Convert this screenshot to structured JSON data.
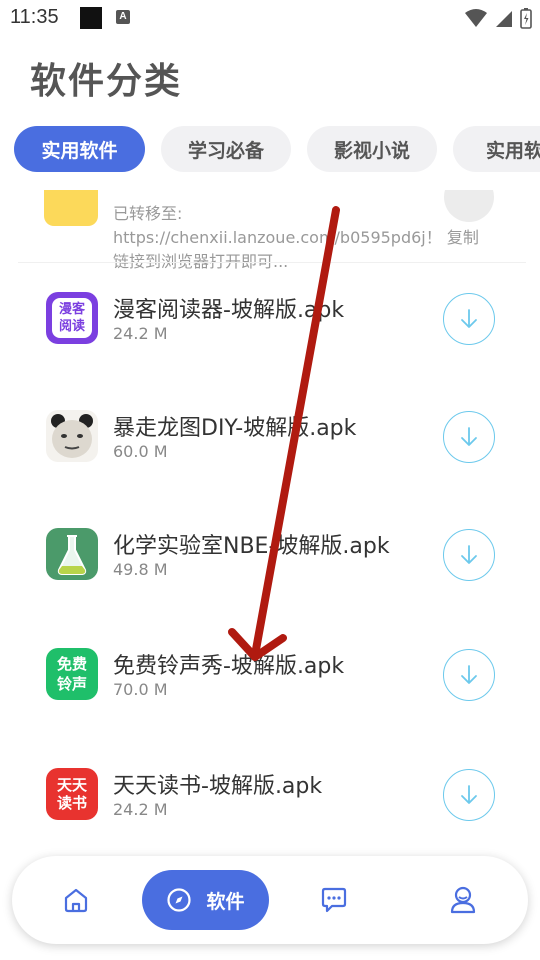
{
  "status_bar": {
    "time": "11:35",
    "notification_icon_letter": "A"
  },
  "page": {
    "title": "软件分类"
  },
  "tabs": [
    {
      "label": "实用软件",
      "active": true
    },
    {
      "label": "学习必备",
      "active": false
    },
    {
      "label": "影视小说",
      "active": false
    },
    {
      "label": "实用软",
      "active": false
    }
  ],
  "notice": {
    "line1": "已转移至:",
    "line2": "https://chenxii.lanzoue.com/b0595pd6j！ 复制",
    "line3": "链接到浏览器打开即可..."
  },
  "apps": [
    {
      "name": "漫客阅读器-坡解版.apk",
      "size": "24.2 M",
      "icon_text": "漫客\n阅读",
      "icon_color": "#7b3fe0"
    },
    {
      "name": "暴走龙图DIY-坡解版.apk",
      "size": "60.0 M",
      "icon_text": "",
      "icon_color": "#e8e4de"
    },
    {
      "name": "化学实验室NBE-坡解版.apk",
      "size": "49.8 M",
      "icon_text": "",
      "icon_color": "#4b9a6a"
    },
    {
      "name": "免费铃声秀-坡解版.apk",
      "size": "70.0 M",
      "icon_text": "免费\n铃声",
      "icon_color": "#1fbf6a"
    },
    {
      "name": "天天读书-坡解版.apk",
      "size": "24.2 M",
      "icon_text": "天天\n读书",
      "icon_color": "#e8332f"
    }
  ],
  "bottom_nav": {
    "items": [
      {
        "icon": "home-icon",
        "label": ""
      },
      {
        "icon": "compass-icon",
        "label": "软件",
        "active": true
      },
      {
        "icon": "chat-icon",
        "label": ""
      },
      {
        "icon": "profile-icon",
        "label": ""
      }
    ]
  },
  "colors": {
    "accent": "#4a6ee0",
    "download_outline": "#6cc9ec",
    "annotation_arrow": "#b01a10"
  }
}
